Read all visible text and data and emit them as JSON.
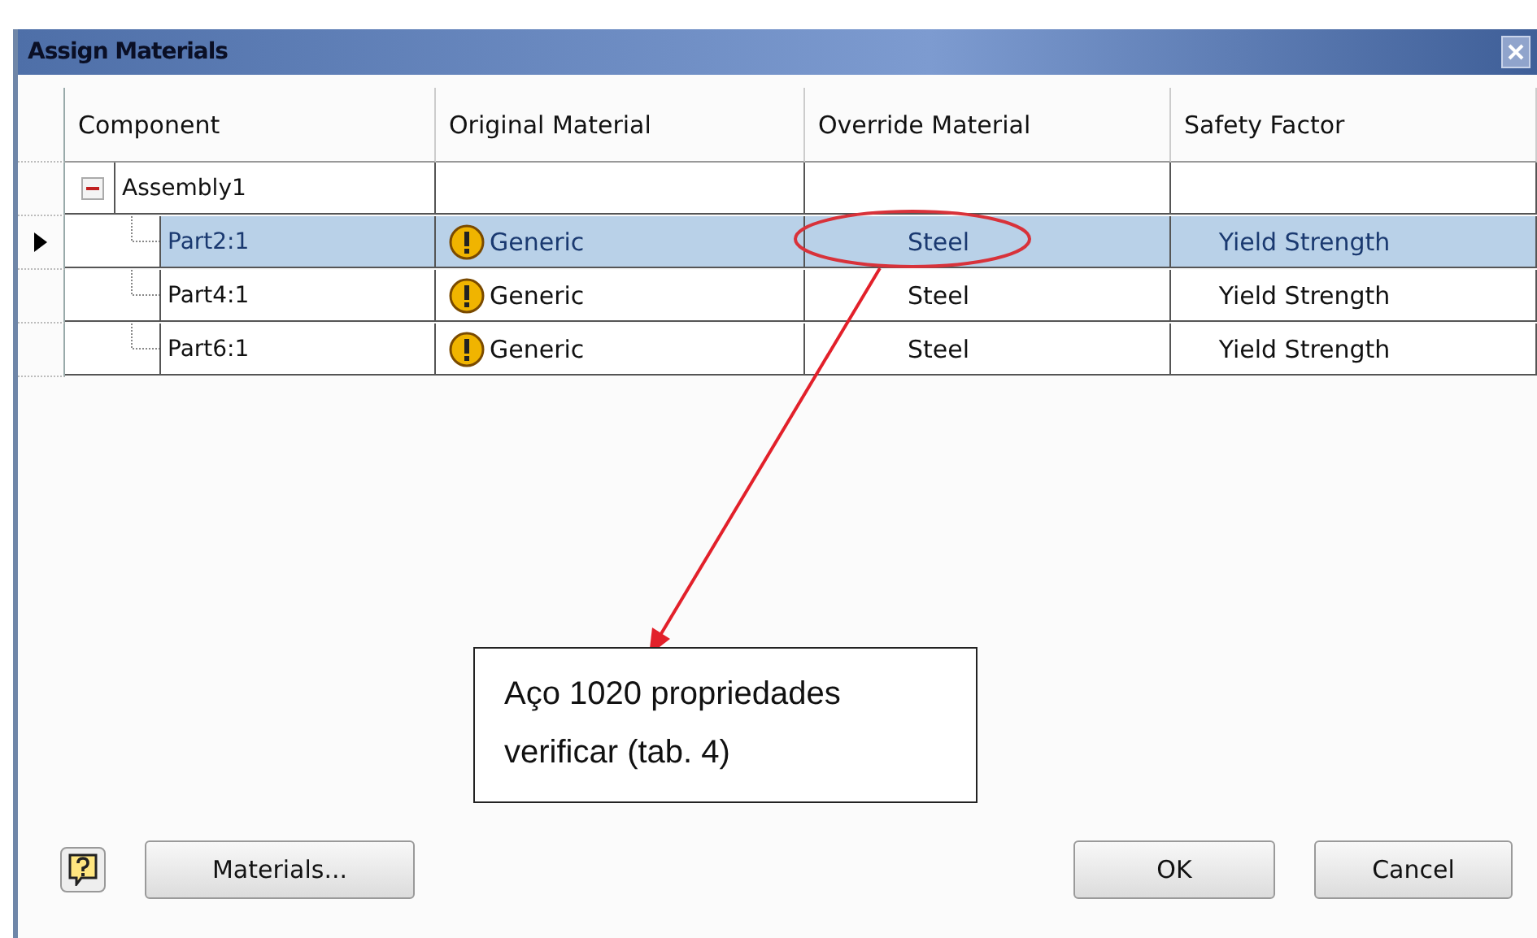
{
  "window": {
    "title": "Assign Materials"
  },
  "table": {
    "columns": [
      "Component",
      "Original Material",
      "Override Material",
      "Safety Factor"
    ],
    "rows": [
      {
        "component": "Assembly1",
        "expanded": true,
        "selected": false,
        "children": [
          {
            "component": "Part2:1",
            "original_material": "Generic",
            "override_material": "Steel",
            "safety_factor": "Yield Strength",
            "selected": true
          },
          {
            "component": "Part4:1",
            "original_material": "Generic",
            "override_material": "Steel",
            "safety_factor": "Yield Strength",
            "selected": false
          },
          {
            "component": "Part6:1",
            "original_material": "Generic",
            "override_material": "Steel",
            "safety_factor": "Yield Strength",
            "selected": false
          }
        ]
      }
    ]
  },
  "annotation": {
    "text": "Aço 1020 propriedades verificar (tab. 4)"
  },
  "buttons": {
    "materials": "Materials...",
    "ok": "OK",
    "cancel": "Cancel"
  }
}
